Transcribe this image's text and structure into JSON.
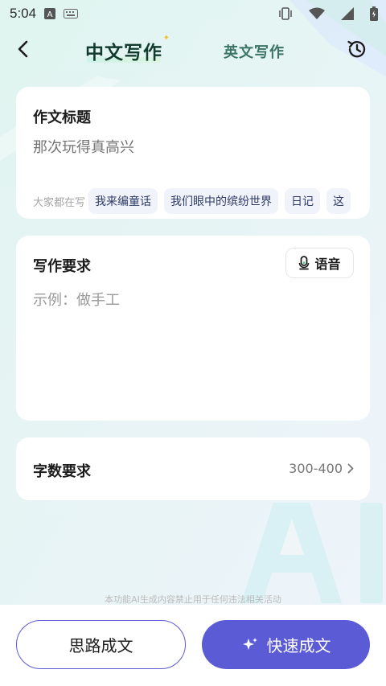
{
  "status_bar": {
    "time": "5:04",
    "icons": [
      "a-badge-icon",
      "keyboard-icon",
      "vibrate-icon",
      "wifi-icon",
      "signal-icon",
      "battery-icon"
    ]
  },
  "header": {
    "back_icon": "chevron-left-icon",
    "tabs": [
      {
        "label": "中文写作",
        "active": true
      },
      {
        "label": "英文写作",
        "active": false
      }
    ],
    "history_icon": "history-icon"
  },
  "title_card": {
    "heading": "作文标题",
    "input_placeholder": "那次玩得真高兴",
    "suggest_label": "大家都在写",
    "suggestions": [
      "我来编童话",
      "我们眼中的缤纷世界",
      "日记",
      "这"
    ]
  },
  "requirement_card": {
    "heading": "写作要求",
    "voice_label": "语音",
    "voice_icon": "microphone-icon",
    "placeholder": "示例：做手工"
  },
  "wordcount_card": {
    "heading": "字数要求",
    "value": "300-400",
    "arrow_icon": "chevron-right-icon"
  },
  "disclaimer": "本功能AI生成内容禁止用于任何违法相关活动",
  "actions": {
    "outline_label": "思路成文",
    "primary_label": "快速成文",
    "primary_icon": "sparkle-icon"
  },
  "colors": {
    "accent": "#5b5bd6",
    "chip_bg": "#f1f3fb",
    "chip_text": "#2d3b66",
    "tab_active": "#123b2e",
    "tab_inactive": "#3b7464"
  }
}
